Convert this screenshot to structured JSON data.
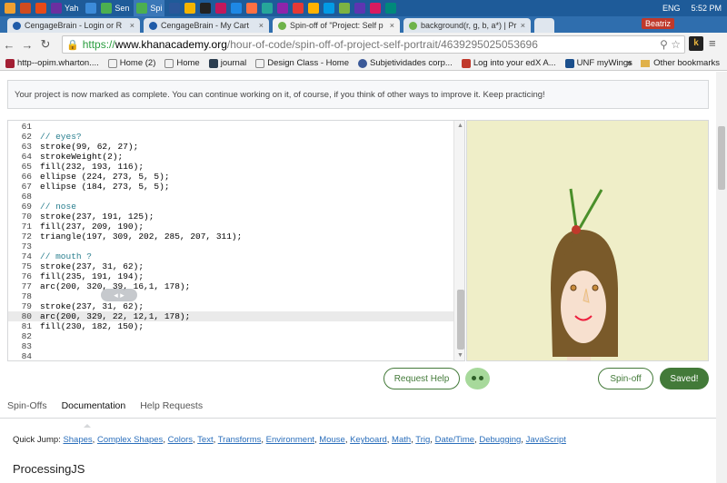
{
  "taskbar": {
    "items": [
      {
        "label": "Yah"
      },
      {
        "label": "Sen"
      },
      {
        "label": "Spi"
      }
    ],
    "tray": {
      "language": "ENG",
      "time": "5:52 PM"
    }
  },
  "browser": {
    "tabs": [
      {
        "label": "CengageBrain - Login or R"
      },
      {
        "label": "CengageBrain - My Cart"
      },
      {
        "label": "Spin-off of \"Project: Self p"
      },
      {
        "label": "background(r, g, b, a*) | Pr"
      }
    ],
    "user": "Beatriz",
    "url": {
      "scheme": "https://",
      "host": "www.khanacademy.org",
      "path": "/hour-of-code/spin-off-of-project-self-portrait/4639295025053696"
    },
    "ka_label": "k",
    "bookmarks": [
      {
        "label": "http--opim.wharton...."
      },
      {
        "label": "Home (2)"
      },
      {
        "label": "Home"
      },
      {
        "label": "journal"
      },
      {
        "label": "Design Class - Home"
      },
      {
        "label": "Subjetividades corp..."
      },
      {
        "label": "Log into your edX A..."
      },
      {
        "label": "UNF myWings"
      }
    ],
    "bookmarks_more": "»",
    "other_bookmarks": "Other bookmarks"
  },
  "notice": "Your project is now marked as complete. You can continue working on it, of course, if you think of other ways to improve it. Keep practicing!",
  "code_lines": [
    {
      "n": "61",
      "code": ""
    },
    {
      "n": "62",
      "code": "// eyes?"
    },
    {
      "n": "63",
      "code": "stroke(99, 62, 27);"
    },
    {
      "n": "64",
      "code": "strokeWeight(2);"
    },
    {
      "n": "65",
      "code": "fill(232, 193, 116);"
    },
    {
      "n": "66",
      "code": "ellipse (224, 273, 5, 5);"
    },
    {
      "n": "67",
      "code": "ellipse (184, 273, 5, 5);"
    },
    {
      "n": "68",
      "code": ""
    },
    {
      "n": "69",
      "code": "// nose"
    },
    {
      "n": "70",
      "code": "stroke(237, 191, 125);"
    },
    {
      "n": "71",
      "code": "fill(237, 209, 190);"
    },
    {
      "n": "72",
      "code": "triangle(197, 309, 202, 285, 207, 311);"
    },
    {
      "n": "73",
      "code": ""
    },
    {
      "n": "74",
      "code": "// mouth ?"
    },
    {
      "n": "75",
      "code": "stroke(237, 31, 62);"
    },
    {
      "n": "76",
      "code": "fill(235, 191, 194);"
    },
    {
      "n": "77",
      "code": "arc(200, 320, 39, 16,1, 178);"
    },
    {
      "n": "78",
      "code": ""
    },
    {
      "n": "79",
      "code": "stroke(237, 31, 62);"
    },
    {
      "n": "80",
      "code": "arc(200, 329, 22, 12,1, 178);"
    },
    {
      "n": "81",
      "code": "fill(230, 182, 150);"
    },
    {
      "n": "82",
      "code": ""
    },
    {
      "n": "83",
      "code": ""
    },
    {
      "n": "84",
      "code": ""
    }
  ],
  "scrubber": "◂ ▸",
  "buttons": {
    "request_help": "Request Help",
    "spinoff": "Spin-off",
    "saved": "Saved!"
  },
  "subtabs": [
    "Spin-Offs",
    "Documentation",
    "Help Requests"
  ],
  "quickjump": {
    "label": "Quick Jump:",
    "links": [
      "Shapes",
      "Complex Shapes",
      "Colors",
      "Text",
      "Transforms",
      "Environment",
      "Mouse",
      "Keyboard",
      "Math",
      "Trig",
      "Date/Time",
      "Debugging",
      "JavaScript"
    ]
  },
  "section_heading": "ProcessingJS",
  "colors": {
    "accent": "#437a39",
    "canvas_bg": "#efeec8"
  }
}
